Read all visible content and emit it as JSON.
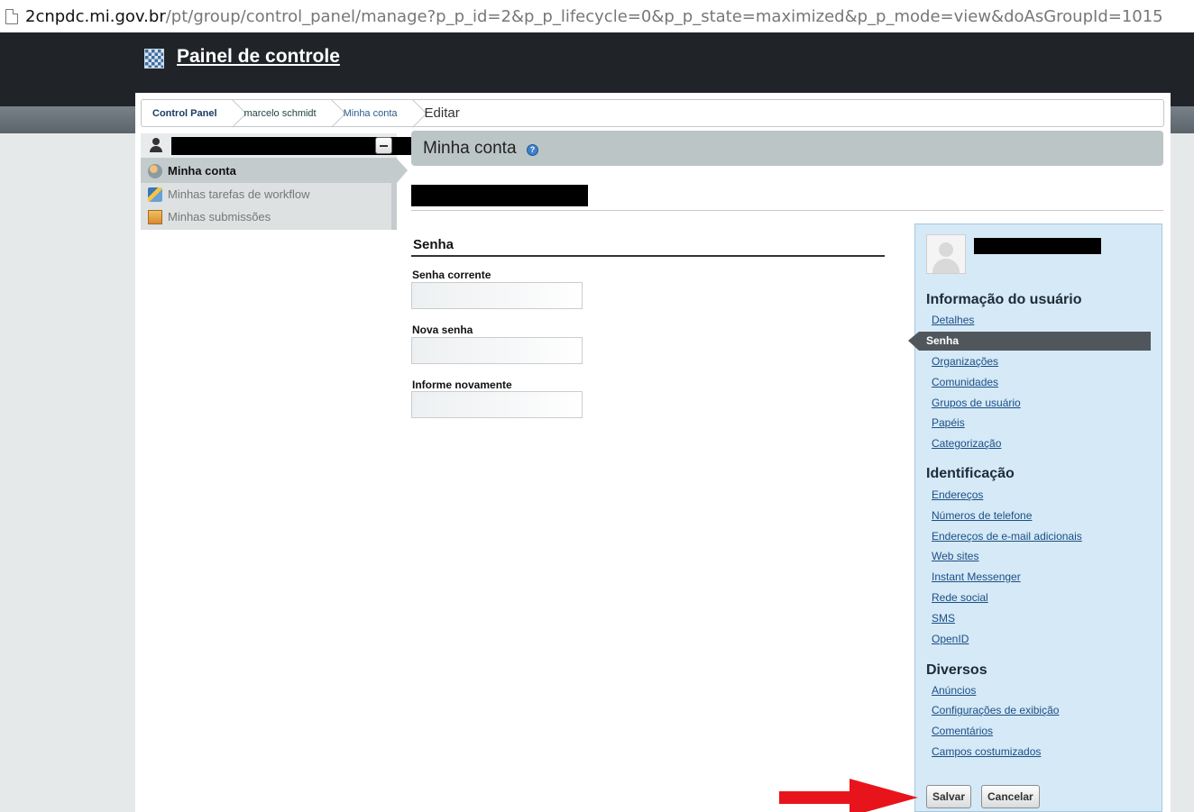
{
  "browser": {
    "url_host": "2cnpdc.mi.gov.br",
    "url_path": "/pt/group/control_panel/manage?p_p_id=2&p_p_lifecycle=0&p_p_state=maximized&p_p_mode=view&doAsGroupId=1015"
  },
  "header": {
    "title": "Painel de controle"
  },
  "breadcrumb": [
    {
      "label": "Control Panel"
    },
    {
      "label": "marcelo schmidt"
    },
    {
      "label": "Minha conta"
    },
    {
      "label": "Editar"
    }
  ],
  "leftnav": {
    "items": [
      {
        "label": "Minha conta",
        "icon": "gear-user-icon"
      },
      {
        "label": "Minhas tarefas de workflow",
        "icon": "workflow-icon"
      },
      {
        "label": "Minhas submissões",
        "icon": "submissions-icon"
      }
    ]
  },
  "content": {
    "title": "Minha conta",
    "help_icon": "help-icon"
  },
  "password_form": {
    "section_title": "Senha",
    "fields": [
      {
        "label": "Senha corrente",
        "value": ""
      },
      {
        "label": "Nova senha",
        "value": ""
      },
      {
        "label": "Informe novamente",
        "value": ""
      }
    ]
  },
  "rightpanel": {
    "user_info_heading": "Informação do usuário",
    "user_info_links": [
      "Detalhes",
      "Senha",
      "Organizações",
      "Comunidades",
      "Grupos de usuário",
      "Papéis",
      "Categorização"
    ],
    "identification_heading": "Identificação",
    "identification_links": [
      "Endereços",
      "Números de telefone",
      "Endereços de e-mail adicionais",
      "Web sites",
      "Instant Messenger",
      "Rede social",
      "SMS",
      "OpenID"
    ],
    "misc_heading": "Diversos",
    "misc_links": [
      "Anúncios",
      "Configurações de exibição",
      "Comentários",
      "Campos costumizados"
    ],
    "selected": "Senha"
  },
  "actions": {
    "save_label": "Salvar",
    "cancel_label": "Cancelar"
  },
  "colors": {
    "arrow": "#e8141b",
    "selected_bg": "#50575c",
    "panel_bg": "#d5e9f6"
  }
}
